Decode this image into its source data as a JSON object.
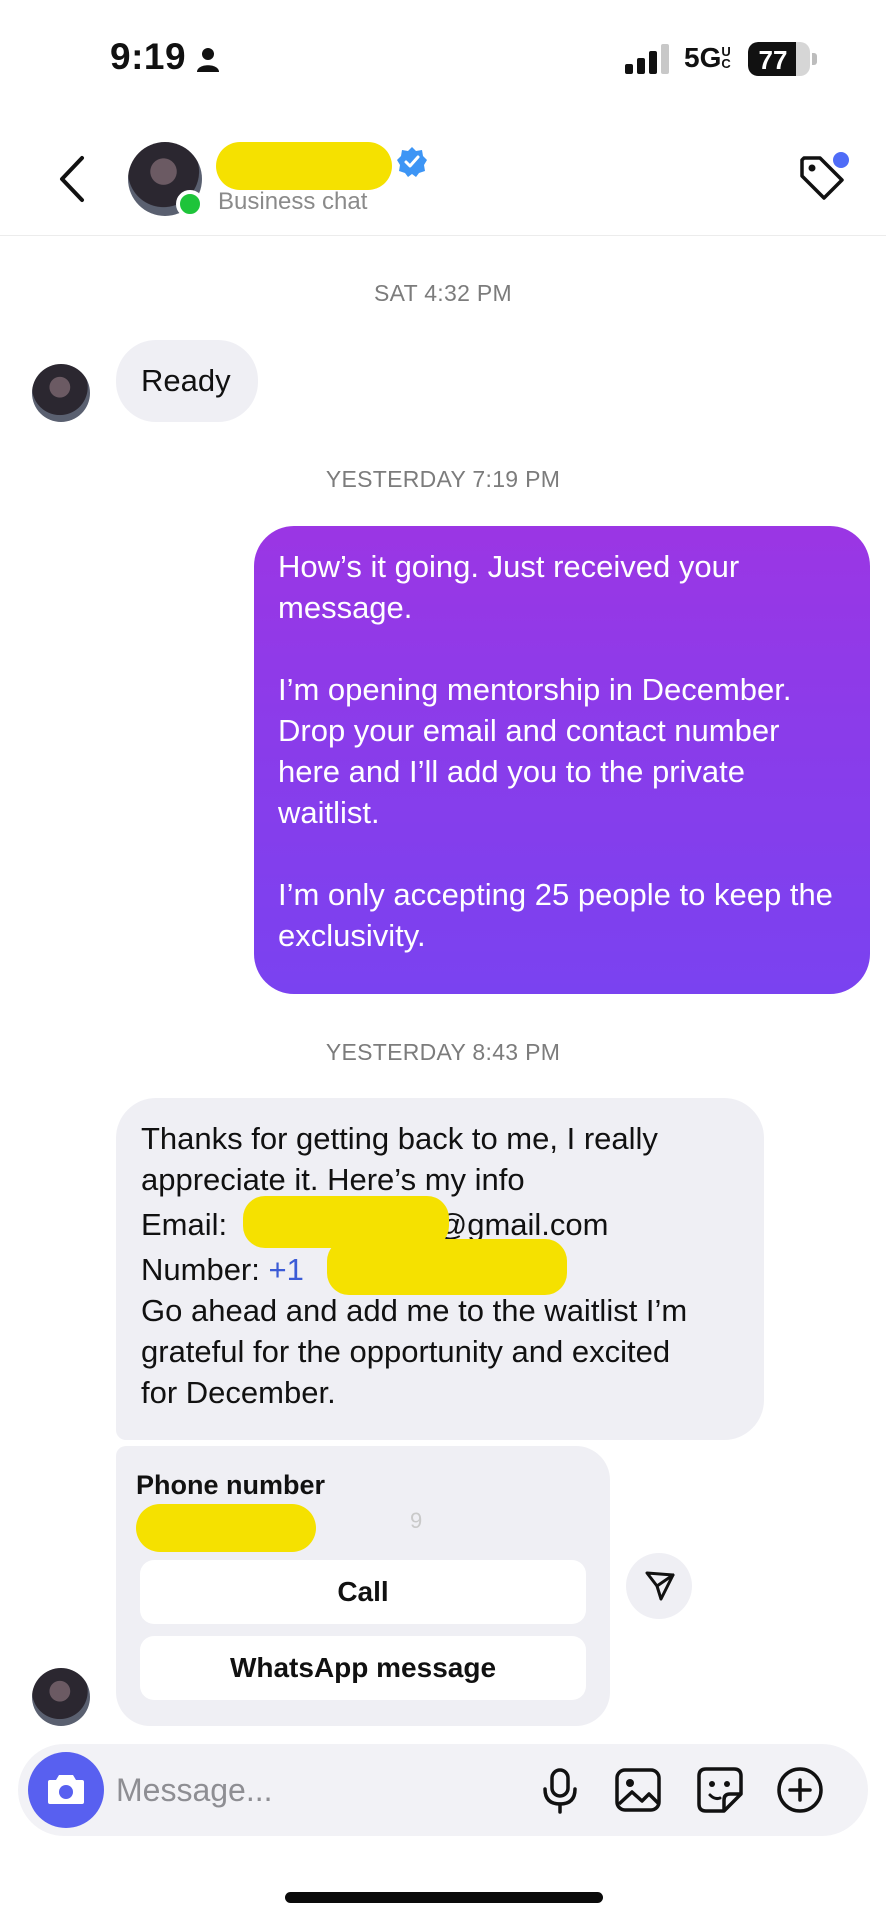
{
  "status_bar": {
    "time": "9:19",
    "network": "5G",
    "network_suffix": "UC",
    "battery": "77",
    "battery_level": 0.77
  },
  "header": {
    "subtitle": "Business chat"
  },
  "messages": {
    "stamp_1": "SAT 4:32 PM",
    "ready": "Ready",
    "stamp_2": "YESTERDAY 7:19 PM",
    "outgoing": {
      "para_1": "How’s it going. Just received your message.",
      "para_2": "I’m opening mentorship in December. Drop your email and contact number here and I’ll add you to the private waitlist.",
      "para_3": "I’m only accepting 25 people to keep the exclusivity."
    },
    "stamp_3": "YESTERDAY 8:43 PM",
    "incoming": {
      "line_1": "Thanks for getting back to me, I really",
      "line_2": "appreciate it. Here’s my info",
      "email_label": "Email: ",
      "email_visible": "@gmail.com",
      "number_label": "Number: ",
      "number_visible": "+1",
      "line_5": "Go ahead and add me to the waitlist I’m",
      "line_6": "grateful for the opportunity and excited",
      "line_7": "for December."
    }
  },
  "phone_card": {
    "title": "Phone number",
    "partial_digit": "9",
    "call_label": "Call",
    "whatsapp_label": "WhatsApp message"
  },
  "composer": {
    "placeholder": "Message..."
  },
  "colors": {
    "accent": "#5860f0",
    "outgoing_top": "#9b36e4",
    "outgoing_bottom": "#7a42f0",
    "incoming_bg": "#efeff4",
    "online": "#1ec43a",
    "redaction": "#f5e100",
    "link": "#3b5bd6"
  },
  "icons": {
    "back": "chevron-left-icon",
    "verified": "verified-badge-icon",
    "tag": "tag-icon",
    "share": "send-icon",
    "camera": "camera-icon",
    "mic": "microphone-icon",
    "gallery": "image-icon",
    "sticker": "sticker-icon",
    "add": "plus-circle-icon"
  }
}
